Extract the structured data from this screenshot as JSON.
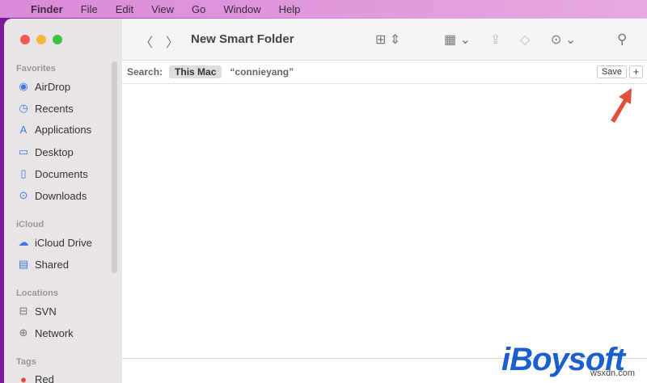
{
  "menubar": {
    "app": "Finder",
    "items": [
      "File",
      "Edit",
      "View",
      "Go",
      "Window",
      "Help"
    ]
  },
  "window": {
    "title": "New Smart Folder"
  },
  "sidebar": {
    "favorites_label": "Favorites",
    "favorites": [
      {
        "label": "AirDrop",
        "icon": "airdrop-icon"
      },
      {
        "label": "Recents",
        "icon": "clock-icon"
      },
      {
        "label": "Applications",
        "icon": "applications-icon"
      },
      {
        "label": "Desktop",
        "icon": "desktop-icon"
      },
      {
        "label": "Documents",
        "icon": "document-icon"
      },
      {
        "label": "Downloads",
        "icon": "download-icon"
      }
    ],
    "icloud_label": "iCloud",
    "icloud": [
      {
        "label": "iCloud Drive",
        "icon": "cloud-icon"
      },
      {
        "label": "Shared",
        "icon": "shared-folder-icon"
      }
    ],
    "locations_label": "Locations",
    "locations": [
      {
        "label": "SVN",
        "icon": "drive-icon"
      },
      {
        "label": "Network",
        "icon": "globe-icon"
      }
    ],
    "tags_label": "Tags",
    "tags": [
      {
        "label": "Red",
        "color": "#e0443a"
      }
    ]
  },
  "search": {
    "label": "Search:",
    "scope": "This Mac",
    "query": "“connieyang”",
    "save": "Save",
    "add": "+"
  },
  "watermark": {
    "logo": "iBoysoft",
    "site": "wsxdn.com"
  }
}
